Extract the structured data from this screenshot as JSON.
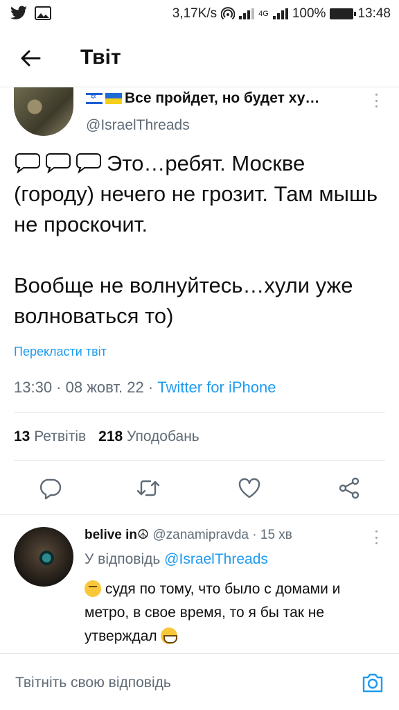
{
  "status_bar": {
    "speed": "3,17K/s",
    "network": "4G",
    "battery": "100%",
    "time": "13:48"
  },
  "header": {
    "title": "Твіт"
  },
  "tweet": {
    "author_name": "Все пройдет, но будет ху…",
    "author_handle": "@IsraelThreads",
    "paragraph_1": "Это…ребят. Москве (городу) нечего не грозит. Там мышь не проскочит.",
    "paragraph_2": "Вообще не волнуйтесь…хули уже волноваться то)",
    "translate_label": "Перекласти твіт",
    "time": "13:30",
    "date": "08 жовт. 22",
    "source": "Twitter for iPhone",
    "retweets_count": "13",
    "retweets_label": "Ретвітів",
    "likes_count": "218",
    "likes_label": "Уподобань"
  },
  "reply": {
    "author_name": "belive in☮",
    "author_handle": "@zanamipravda",
    "time": "15 хв",
    "reply_to_prefix": "У відповідь",
    "reply_to_handle": "@IsraelThreads",
    "text": "судя по тому, что было с домами и метро, в свое время, то я бы так не утверждал"
  },
  "composer": {
    "placeholder": "Твітніть свою відповідь"
  },
  "icons": {
    "back": "arrow-left-icon",
    "more": "more-vertical-icon",
    "reply": "reply-icon",
    "retweet": "retweet-icon",
    "like": "heart-icon",
    "share": "share-icon",
    "camera": "camera-icon"
  },
  "colors": {
    "link": "#1d9bf0",
    "secondary_text": "#5f6b76",
    "primary_text": "#111111"
  }
}
